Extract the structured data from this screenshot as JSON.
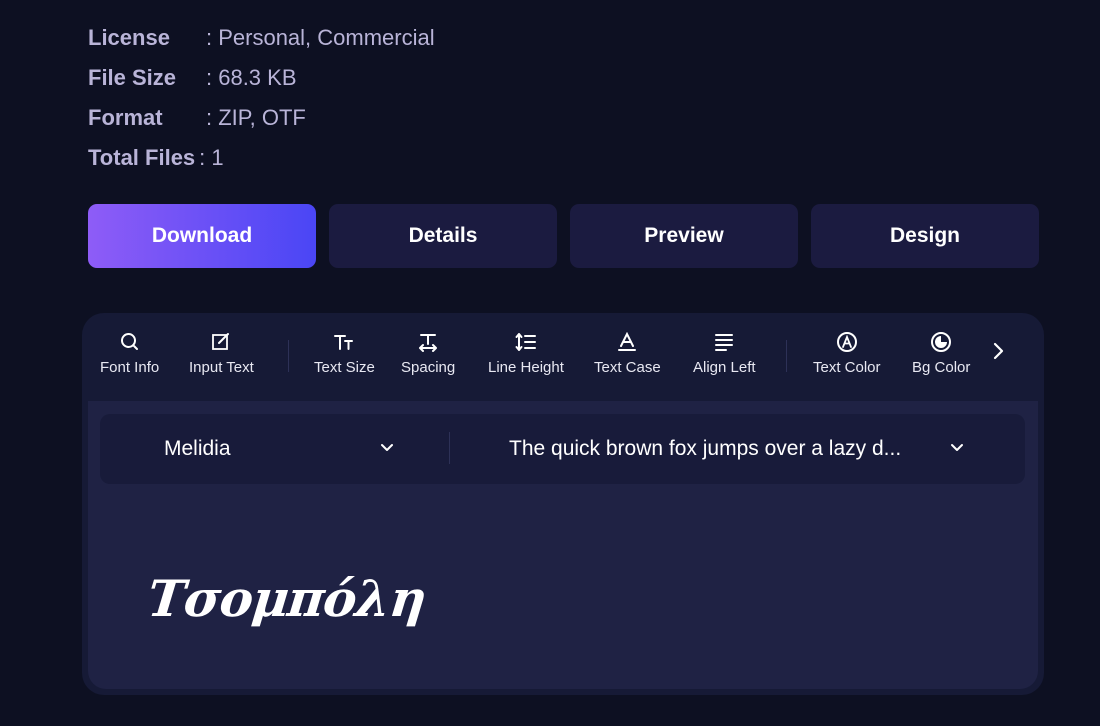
{
  "meta": [
    {
      "key": "License",
      "value": ": Personal, Commercial"
    },
    {
      "key": "File Size",
      "value": ": 68.3 KB"
    },
    {
      "key": "Format",
      "value": ": ZIP, OTF"
    },
    {
      "key": "Total Files",
      "value": ": 1"
    }
  ],
  "buttons": {
    "download": "Download",
    "details": "Details",
    "preview": "Preview",
    "design": "Design"
  },
  "toolbar": {
    "font_info": "Font Info",
    "input_text": "Input Text",
    "text_size": "Text Size",
    "spacing": "Spacing",
    "line_height": "Line Height",
    "text_case": "Text Case",
    "align_left": "Align Left",
    "text_color": "Text Color",
    "bg_color": "Bg Color"
  },
  "selectors": {
    "font": "Melidia",
    "sample": "The quick brown fox jumps over a lazy d..."
  },
  "preview": {
    "text": "Τσομπόλη"
  },
  "colors": {
    "background": "#0d1022",
    "accent_start": "#8e5cf7",
    "accent_end": "#4a46f5",
    "button": "#1b1b40"
  }
}
